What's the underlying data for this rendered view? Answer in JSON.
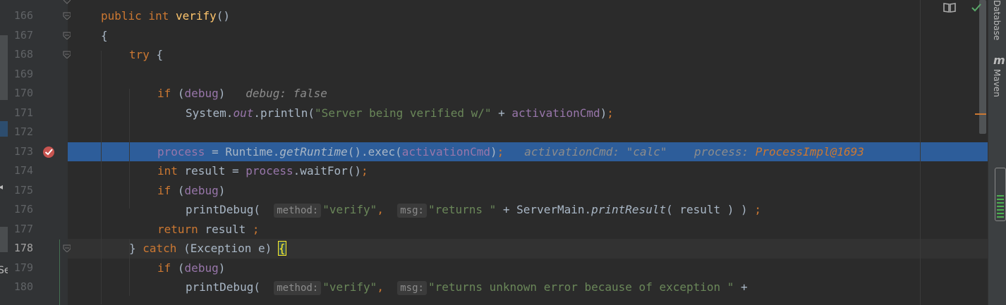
{
  "lines": [
    {
      "num": "166",
      "current": false,
      "highlighted": false,
      "indent": 0,
      "tokens": [
        {
          "t": "public int ",
          "c": "kw"
        },
        {
          "t": "verify",
          "c": "fn"
        },
        {
          "t": "()",
          "c": ""
        }
      ]
    },
    {
      "num": "167",
      "current": false,
      "highlighted": false,
      "indent": 0,
      "tokens": [
        {
          "t": "{",
          "c": ""
        }
      ]
    },
    {
      "num": "168",
      "current": false,
      "highlighted": false,
      "indent": 1,
      "tokens": [
        {
          "t": "try ",
          "c": "kw"
        },
        {
          "t": "{",
          "c": ""
        }
      ]
    },
    {
      "num": "169",
      "current": false,
      "highlighted": false,
      "indent": 1,
      "tokens": []
    },
    {
      "num": "170",
      "current": false,
      "highlighted": false,
      "indent": 2,
      "tokens": [
        {
          "t": "if ",
          "c": "kw"
        },
        {
          "t": "(",
          "c": ""
        },
        {
          "t": "debug",
          "c": "fld"
        },
        {
          "t": ")   ",
          "c": ""
        },
        {
          "t": "debug: false",
          "c": "dbg"
        }
      ]
    },
    {
      "num": "171",
      "current": false,
      "highlighted": false,
      "indent": 3,
      "tokens": [
        {
          "t": "System.",
          "c": ""
        },
        {
          "t": "out",
          "c": "fld it"
        },
        {
          "t": ".println(",
          "c": ""
        },
        {
          "t": "\"Server being verified w/\"",
          "c": "str"
        },
        {
          "t": " + ",
          "c": ""
        },
        {
          "t": "activationCmd",
          "c": "fld"
        },
        {
          "t": ")",
          "c": ""
        },
        {
          "t": ";",
          "c": "kw"
        }
      ]
    },
    {
      "num": "172",
      "current": false,
      "highlighted": false,
      "indent": 2,
      "tokens": []
    },
    {
      "num": "173",
      "current": false,
      "highlighted": true,
      "indent": 2,
      "tokens": [
        {
          "t": "process",
          "c": "fld"
        },
        {
          "t": " = Runtime.",
          "c": ""
        },
        {
          "t": "getRuntime",
          "c": "it"
        },
        {
          "t": "().exec(",
          "c": ""
        },
        {
          "t": "activationCmd",
          "c": "fld"
        },
        {
          "t": ")",
          "c": ""
        },
        {
          "t": ";",
          "c": "kw"
        },
        {
          "t": "   activationCmd: \"calc\"    process: ",
          "c": "dbg"
        },
        {
          "t": "ProcessImpl@1693",
          "c": "dbgv"
        }
      ]
    },
    {
      "num": "174",
      "current": false,
      "highlighted": false,
      "indent": 2,
      "tokens": [
        {
          "t": "int ",
          "c": "kw"
        },
        {
          "t": "result = ",
          "c": ""
        },
        {
          "t": "process",
          "c": "fld"
        },
        {
          "t": ".waitFor()",
          "c": ""
        },
        {
          "t": ";",
          "c": "kw"
        }
      ]
    },
    {
      "num": "175",
      "current": false,
      "highlighted": false,
      "indent": 2,
      "tokens": [
        {
          "t": "if ",
          "c": "kw"
        },
        {
          "t": "(",
          "c": ""
        },
        {
          "t": "debug",
          "c": "fld"
        },
        {
          "t": ")",
          "c": ""
        }
      ]
    },
    {
      "num": "176",
      "current": false,
      "highlighted": false,
      "indent": 3,
      "tokens": [
        {
          "t": "printDebug(  ",
          "c": ""
        },
        {
          "t": "method:",
          "c": "hint"
        },
        {
          "t": "\"verify\"",
          "c": "str"
        },
        {
          "t": ",  ",
          "c": "kw"
        },
        {
          "t": "msg:",
          "c": "hint"
        },
        {
          "t": "\"returns \"",
          "c": "str"
        },
        {
          "t": " + ServerMain.",
          "c": ""
        },
        {
          "t": "printResult",
          "c": "it"
        },
        {
          "t": "( result ) ) ",
          "c": ""
        },
        {
          "t": ";",
          "c": "kw"
        }
      ]
    },
    {
      "num": "177",
      "current": false,
      "highlighted": false,
      "indent": 2,
      "tokens": [
        {
          "t": "return ",
          "c": "kw"
        },
        {
          "t": "result ",
          "c": ""
        },
        {
          "t": ";",
          "c": "kw"
        }
      ]
    },
    {
      "num": "178",
      "current": true,
      "highlighted": false,
      "indent": 1,
      "tokens": [
        {
          "t": "} ",
          "c": ""
        },
        {
          "t": "catch ",
          "c": "kw"
        },
        {
          "t": "(Exception e) ",
          "c": ""
        },
        {
          "t": "{",
          "c": "brace-match"
        }
      ]
    },
    {
      "num": "179",
      "current": false,
      "highlighted": false,
      "indent": 2,
      "tokens": [
        {
          "t": "if ",
          "c": "kw"
        },
        {
          "t": "(",
          "c": ""
        },
        {
          "t": "debug",
          "c": "fld"
        },
        {
          "t": ")",
          "c": ""
        }
      ]
    },
    {
      "num": "180",
      "current": false,
      "highlighted": false,
      "indent": 3,
      "tokens": [
        {
          "t": "printDebug(  ",
          "c": ""
        },
        {
          "t": "method:",
          "c": "hint"
        },
        {
          "t": "\"verify\"",
          "c": "str"
        },
        {
          "t": ",  ",
          "c": "kw"
        },
        {
          "t": "msg:",
          "c": "hint"
        },
        {
          "t": "\"returns unknown error because of exception \"",
          "c": "str"
        },
        {
          "t": " +",
          "c": ""
        }
      ]
    }
  ],
  "right_toolbar": {
    "database_label": "Database",
    "maven_label": "Maven",
    "maven_glyph": "m"
  },
  "left_fragments": {
    "arrow": "◂",
    "se": "Se"
  },
  "icons": [
    "book-icon",
    "check-icon",
    "breakpoint-icon",
    "fold-icon",
    "memory-indicator-icon"
  ],
  "colors": {
    "highlight": "#2d5d9a",
    "keyword": "#cc7832",
    "string": "#6a8759",
    "field": "#9876aa",
    "method": "#ffc66d",
    "breakpoint": "#c75450"
  }
}
